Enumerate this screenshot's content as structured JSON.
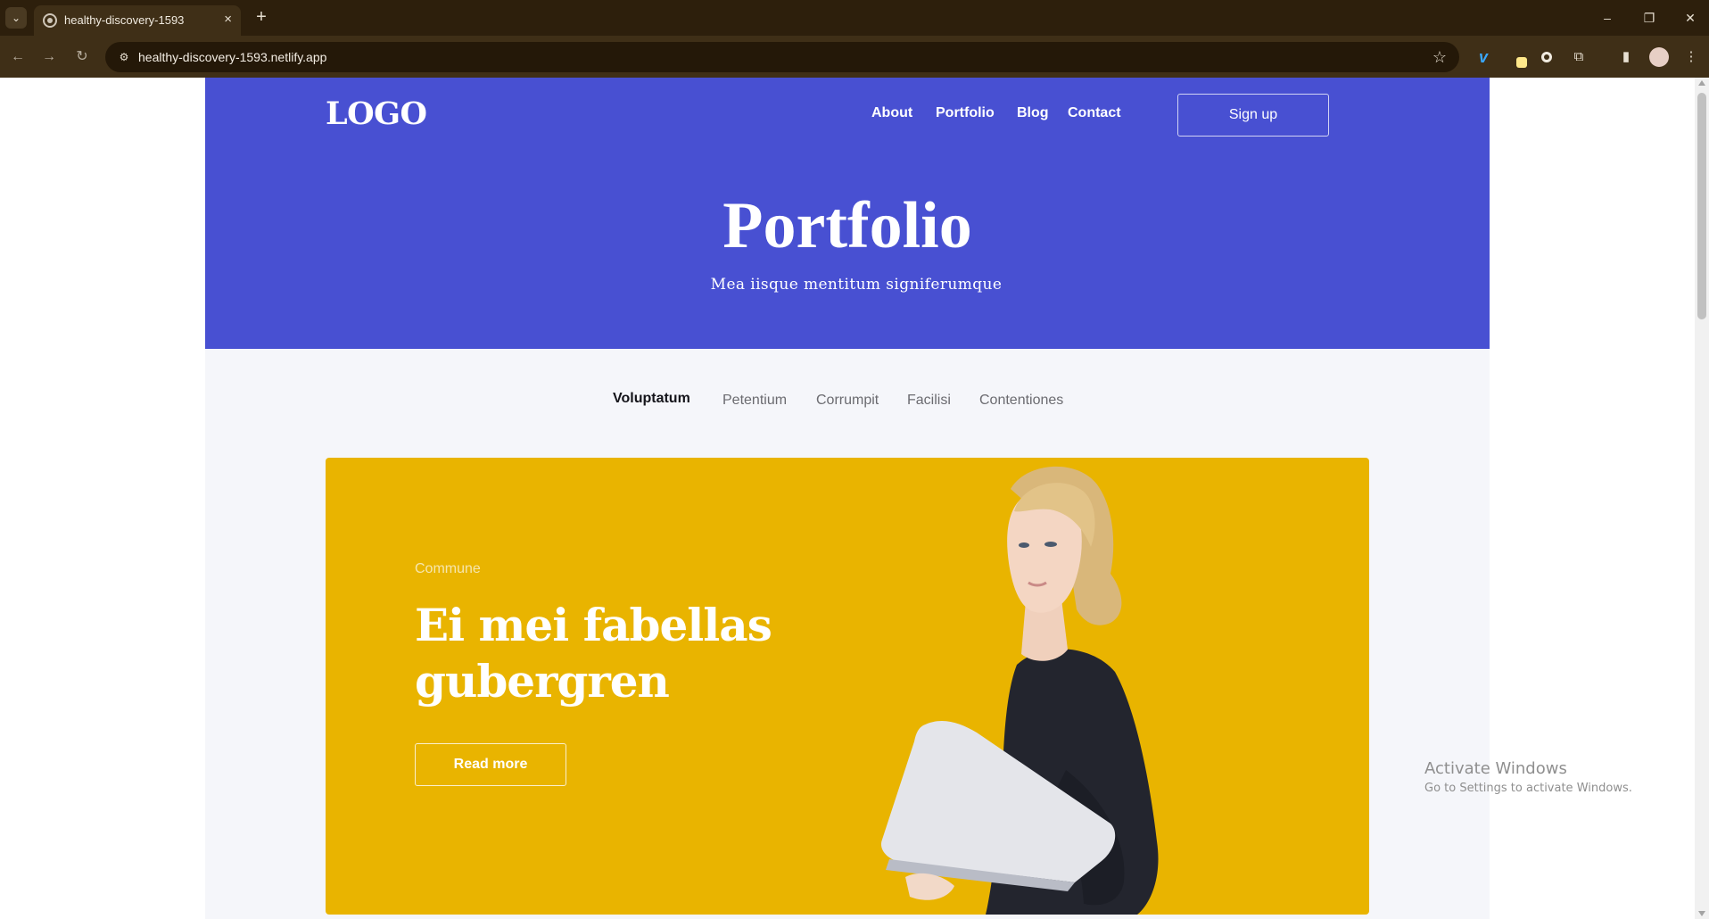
{
  "browser": {
    "tab_title": "healthy-discovery-1593",
    "url": "healthy-discovery-1593.netlify.app",
    "tab_close": "×",
    "new_tab": "+",
    "tab_list": "⌄",
    "back": "←",
    "forward": "→",
    "reload": "↻",
    "site_info": "⚙",
    "bookmark": "☆",
    "minimize": "–",
    "restore": "❐",
    "close": "✕",
    "menu": "⋮",
    "ext_vimeo": "v",
    "ext_puzzle": "⧉",
    "ext_sidepanel": "▮"
  },
  "header": {
    "logo": "LOGO",
    "nav": [
      "About",
      "Portfolio",
      "Blog",
      "Contact"
    ],
    "signup_label": "Sign up"
  },
  "hero": {
    "title": "Portfolio",
    "subtitle": "Mea iisque mentitum signiferumque"
  },
  "filters": {
    "items": [
      "Voluptatum",
      "Petentium",
      "Corrumpit",
      "Facilisi",
      "Contentiones"
    ],
    "active": "Voluptatum"
  },
  "feature": {
    "eyebrow": "Commune",
    "title": "Ei mei fabellas gubergren",
    "button_label": "Read more"
  },
  "watermark": {
    "title": "Activate Windows",
    "subtitle": "Go to Settings to activate Windows."
  },
  "colors": {
    "hero_bg": "#4850d2",
    "card_bg": "#e9b400",
    "page_bg": "#f5f6fa",
    "chrome_bg": "#2d1f0c"
  }
}
